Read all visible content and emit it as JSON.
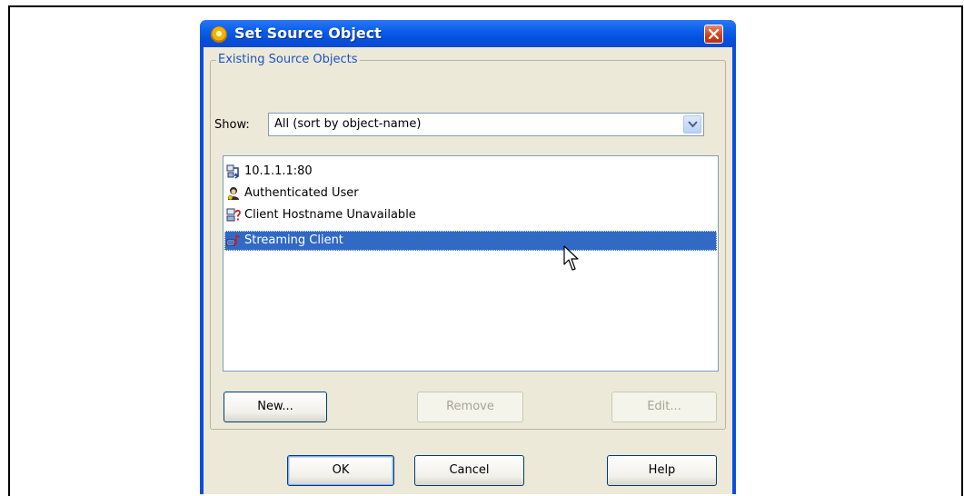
{
  "dialog": {
    "title": "Set Source Object",
    "group_label": "Existing Source Objects",
    "show_label": "Show:",
    "show_value": "All (sort by object-name)",
    "items": [
      {
        "label": "10.1.1.1:80",
        "icon": "network-address-icon",
        "selected": false
      },
      {
        "label": "Authenticated User",
        "icon": "user-icon",
        "selected": false
      },
      {
        "label": "Client Hostname Unavailable",
        "icon": "unknown-host-icon",
        "selected": false
      },
      {
        "label": "Streaming Client",
        "icon": "streaming-client-icon",
        "selected": true
      }
    ],
    "buttons": {
      "new": "New...",
      "remove": "Remove",
      "edit": "Edit...",
      "ok": "OK",
      "cancel": "Cancel",
      "help": "Help"
    }
  },
  "colors": {
    "titlebar": "#0a5fea",
    "selection": "#316ac5",
    "group_label": "#1c52c8"
  }
}
